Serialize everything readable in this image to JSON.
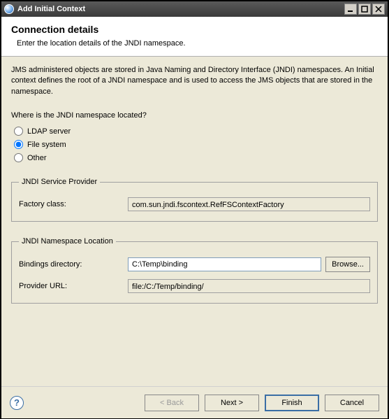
{
  "window": {
    "title": "Add Initial Context"
  },
  "header": {
    "title": "Connection details",
    "subtitle": "Enter the location details of the JNDI namespace."
  },
  "body": {
    "description": "JMS administered objects are stored in Java Naming and Directory Interface (JNDI) namespaces. An Initial context defines the root of a JNDI namespace and is used to access the JMS objects that are stored in the namespace.",
    "question": "Where is the JNDI namespace located?",
    "radios": {
      "ldap": "LDAP server",
      "file": "File system",
      "other": "Other",
      "selected": "file"
    }
  },
  "serviceProvider": {
    "legend": "JNDI Service Provider",
    "factory_label": "Factory class:",
    "factory_value": "com.sun.jndi.fscontext.RefFSContextFactory"
  },
  "namespaceLocation": {
    "legend": "JNDI Namespace Location",
    "bindings_label": "Bindings directory:",
    "bindings_value": "C:\\Temp\\binding",
    "browse_label": "Browse...",
    "provider_label": "Provider URL:",
    "provider_value": "file:/C:/Temp/binding/"
  },
  "footer": {
    "back": "< Back",
    "next": "Next >",
    "finish": "Finish",
    "cancel": "Cancel"
  }
}
